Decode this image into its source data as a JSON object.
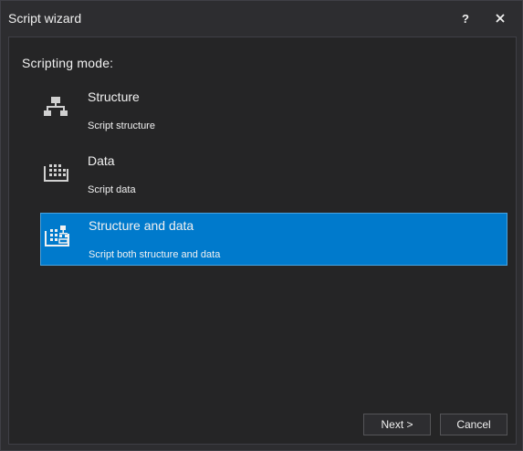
{
  "window": {
    "title": "Script wizard",
    "help_label": "?",
    "close_icon": "close-icon"
  },
  "main": {
    "mode_label": "Scripting mode:",
    "options": [
      {
        "title": "Structure",
        "description": "Script structure",
        "icon": "structure-icon",
        "selected": false
      },
      {
        "title": "Data",
        "description": "Script data",
        "icon": "data-icon",
        "selected": false
      },
      {
        "title": "Structure and data",
        "description": "Script both structure and data",
        "icon": "structure-and-data-icon",
        "selected": true
      }
    ]
  },
  "footer": {
    "next_label": "Next >",
    "cancel_label": "Cancel"
  },
  "colors": {
    "selection": "#007acc",
    "background": "#2d2d30",
    "panel": "#252526"
  }
}
